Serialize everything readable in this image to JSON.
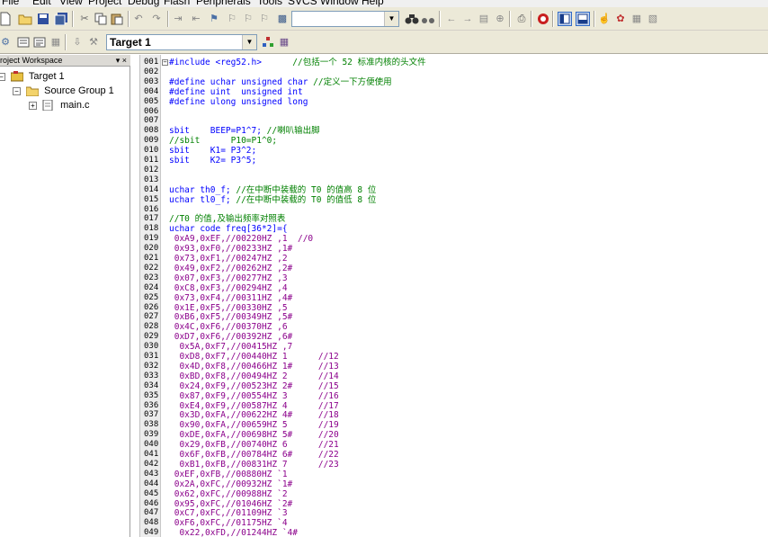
{
  "menu": {
    "items": [
      "File",
      "Edit",
      "View",
      "Project",
      "Debug",
      "Flash",
      "Peripherals",
      "Tools",
      "SVCS",
      "Window",
      "Help"
    ]
  },
  "toolbar": {
    "find_value": "",
    "target_select": "Target 1"
  },
  "workspace": {
    "title": "roject Workspace",
    "close_glyph": "▾ ×",
    "tree": [
      {
        "label": "Target 1",
        "level": 0,
        "expander": "−"
      },
      {
        "label": "Source Group 1",
        "level": 1,
        "expander": "−"
      },
      {
        "label": "main.c",
        "level": 2,
        "expander": "+"
      }
    ]
  },
  "editor": {
    "lines": [
      {
        "n": "001",
        "t": "#include <reg52.h>      //包括一个 52 标准内核的头文件",
        "c": "kw"
      },
      {
        "n": "002",
        "t": "",
        "c": ""
      },
      {
        "n": "003",
        "t": "#define uchar unsigned char //定义一下方便使用",
        "c": "kw"
      },
      {
        "n": "004",
        "t": "#define uint  unsigned int",
        "c": "kw"
      },
      {
        "n": "005",
        "t": "#define ulong unsigned long",
        "c": "kw"
      },
      {
        "n": "006",
        "t": "",
        "c": ""
      },
      {
        "n": "007",
        "t": "",
        "c": ""
      },
      {
        "n": "008",
        "t": "sbit    BEEP=P1^7; //喇叭输出脚",
        "c": "mix"
      },
      {
        "n": "009",
        "t": "//sbit      P10=P1^0;",
        "c": "cm"
      },
      {
        "n": "010",
        "t": "sbit    K1= P3^2;",
        "c": "mix"
      },
      {
        "n": "011",
        "t": "sbit    K2= P3^5;",
        "c": "mix"
      },
      {
        "n": "012",
        "t": "",
        "c": ""
      },
      {
        "n": "013",
        "t": "",
        "c": ""
      },
      {
        "n": "014",
        "t": "uchar th0_f; //在中断中装载的 T0 的值高 8 位",
        "c": "mix"
      },
      {
        "n": "015",
        "t": "uchar tl0_f; //在中断中装载的 T0 的值低 8 位",
        "c": "mix"
      },
      {
        "n": "016",
        "t": "",
        "c": ""
      },
      {
        "n": "017",
        "t": "//T0 的值,及输出频率对照表",
        "c": "cm"
      },
      {
        "n": "018",
        "t": "uchar code freq[36*2]={",
        "c": "mix"
      },
      {
        "n": "019",
        "t": " 0xA9,0xEF,//00220HZ ,1  //0",
        "c": "mg"
      },
      {
        "n": "020",
        "t": " 0x93,0xF0,//00233HZ ,1#",
        "c": "mg"
      },
      {
        "n": "021",
        "t": " 0x73,0xF1,//00247HZ ,2",
        "c": "mg"
      },
      {
        "n": "022",
        "t": " 0x49,0xF2,//00262HZ ,2#",
        "c": "mg"
      },
      {
        "n": "023",
        "t": " 0x07,0xF3,//00277HZ ,3",
        "c": "mg"
      },
      {
        "n": "024",
        "t": " 0xC8,0xF3,//00294HZ ,4",
        "c": "mg"
      },
      {
        "n": "025",
        "t": " 0x73,0xF4,//00311HZ ,4#",
        "c": "mg"
      },
      {
        "n": "026",
        "t": " 0x1E,0xF5,//00330HZ ,5",
        "c": "mg"
      },
      {
        "n": "027",
        "t": " 0xB6,0xF5,//00349HZ ,5#",
        "c": "mg"
      },
      {
        "n": "028",
        "t": " 0x4C,0xF6,//00370HZ ,6",
        "c": "mg"
      },
      {
        "n": "029",
        "t": " 0xD7,0xF6,//00392HZ ,6#",
        "c": "mg"
      },
      {
        "n": "030",
        "t": "  0x5A,0xF7,//00415HZ ,7",
        "c": "mg"
      },
      {
        "n": "031",
        "t": "  0xD8,0xF7,//00440HZ 1      //12",
        "c": "mg"
      },
      {
        "n": "032",
        "t": "  0x4D,0xF8,//00466HZ 1#     //13",
        "c": "mg"
      },
      {
        "n": "033",
        "t": "  0xBD,0xF8,//00494HZ 2      //14",
        "c": "mg"
      },
      {
        "n": "034",
        "t": "  0x24,0xF9,//00523HZ 2#     //15",
        "c": "mg"
      },
      {
        "n": "035",
        "t": "  0x87,0xF9,//00554HZ 3      //16",
        "c": "mg"
      },
      {
        "n": "036",
        "t": "  0xE4,0xF9,//00587HZ 4      //17",
        "c": "mg"
      },
      {
        "n": "037",
        "t": "  0x3D,0xFA,//00622HZ 4#     //18",
        "c": "mg"
      },
      {
        "n": "038",
        "t": "  0x90,0xFA,//00659HZ 5      //19",
        "c": "mg"
      },
      {
        "n": "039",
        "t": "  0xDE,0xFA,//00698HZ 5#     //20",
        "c": "mg"
      },
      {
        "n": "040",
        "t": "  0x29,0xFB,//00740HZ 6      //21",
        "c": "mg"
      },
      {
        "n": "041",
        "t": "  0x6F,0xFB,//00784HZ 6#     //22",
        "c": "mg"
      },
      {
        "n": "042",
        "t": "  0xB1,0xFB,//00831HZ 7      //23",
        "c": "mg"
      },
      {
        "n": "043",
        "t": " 0xEF,0xFB,//00880HZ `1",
        "c": "mg"
      },
      {
        "n": "044",
        "t": " 0x2A,0xFC,//00932HZ `1#",
        "c": "mg"
      },
      {
        "n": "045",
        "t": " 0x62,0xFC,//00988HZ `2",
        "c": "mg"
      },
      {
        "n": "046",
        "t": " 0x95,0xFC,//01046HZ `2#",
        "c": "mg"
      },
      {
        "n": "047",
        "t": " 0xC7,0xFC,//01109HZ `3",
        "c": "mg"
      },
      {
        "n": "048",
        "t": " 0xF6,0xFC,//01175HZ `4",
        "c": "mg"
      },
      {
        "n": "049",
        "t": "  0x22,0xFD,//01244HZ `4#",
        "c": "mg"
      }
    ]
  },
  "colors": {
    "keyword": "#0000ff",
    "comment": "#008000",
    "data": "#8b008b",
    "toolbar_bg": "#ece9d8"
  }
}
